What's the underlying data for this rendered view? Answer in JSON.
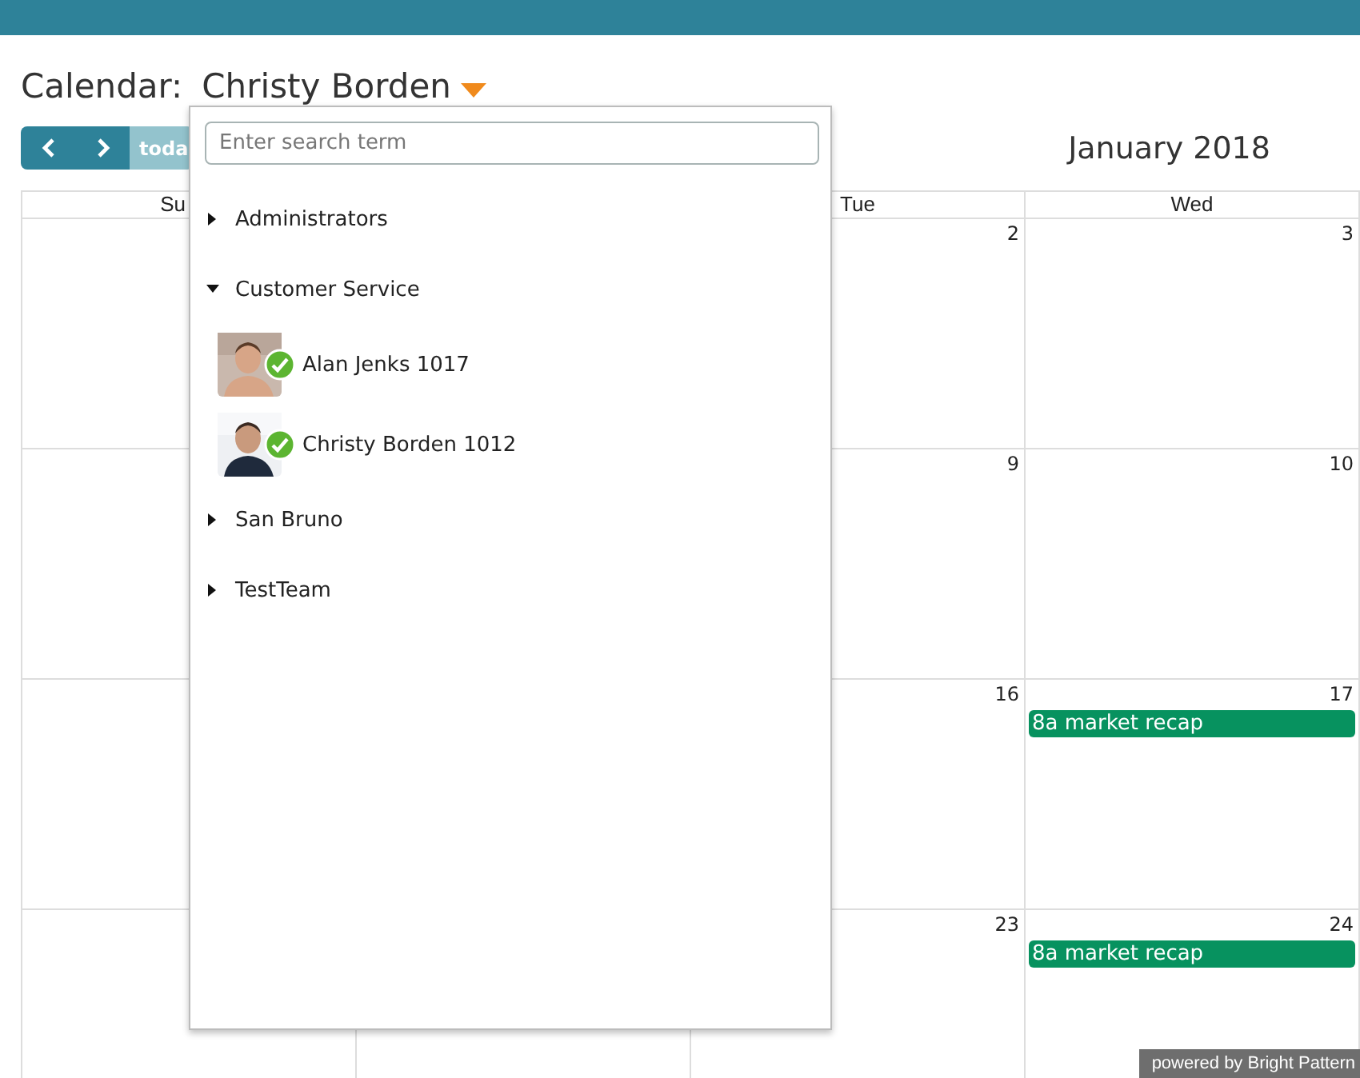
{
  "header": {
    "label": "Calendar:",
    "calendar_owner": "Christy Borden"
  },
  "toolbar": {
    "buttons": [
      {
        "kind": "prev"
      },
      {
        "kind": "next"
      },
      {
        "kind": "today",
        "label": "toda"
      }
    ],
    "month_title": "January 2018"
  },
  "day_headers": [
    {
      "kind": "sun",
      "label": "Su"
    },
    {
      "kind": "tue",
      "label": "Tue"
    },
    {
      "kind": "wed",
      "label": "Wed"
    }
  ],
  "weeks": [
    {
      "cells": [
        {},
        {},
        {
          "day": "2"
        },
        {
          "day": "3"
        }
      ]
    },
    {
      "cells": [
        {},
        {},
        {
          "day": "9"
        },
        {
          "day": "10"
        }
      ]
    },
    {
      "cells": [
        {},
        {},
        {
          "day": "16"
        },
        {
          "day": "17",
          "events": [
            "8a market recap"
          ]
        }
      ]
    },
    {
      "cells": [
        {},
        {},
        {
          "day": "23"
        },
        {
          "day": "24",
          "events": [
            "8a market recap"
          ]
        }
      ]
    }
  ],
  "dropdown": {
    "search": {
      "placeholder": "Enter search term"
    },
    "groups": [
      {
        "label": "Administrators",
        "expanded": false
      },
      {
        "label": "Customer Service",
        "expanded": true,
        "children": [
          {
            "label": "Alan Jenks 1017",
            "available": true
          },
          {
            "label": "Christy Borden 1012",
            "available": true
          }
        ]
      },
      {
        "label": "San Bruno",
        "expanded": false
      },
      {
        "label": "TestTeam",
        "expanded": false
      }
    ]
  },
  "powered_by": "powered by Bright Pattern"
}
